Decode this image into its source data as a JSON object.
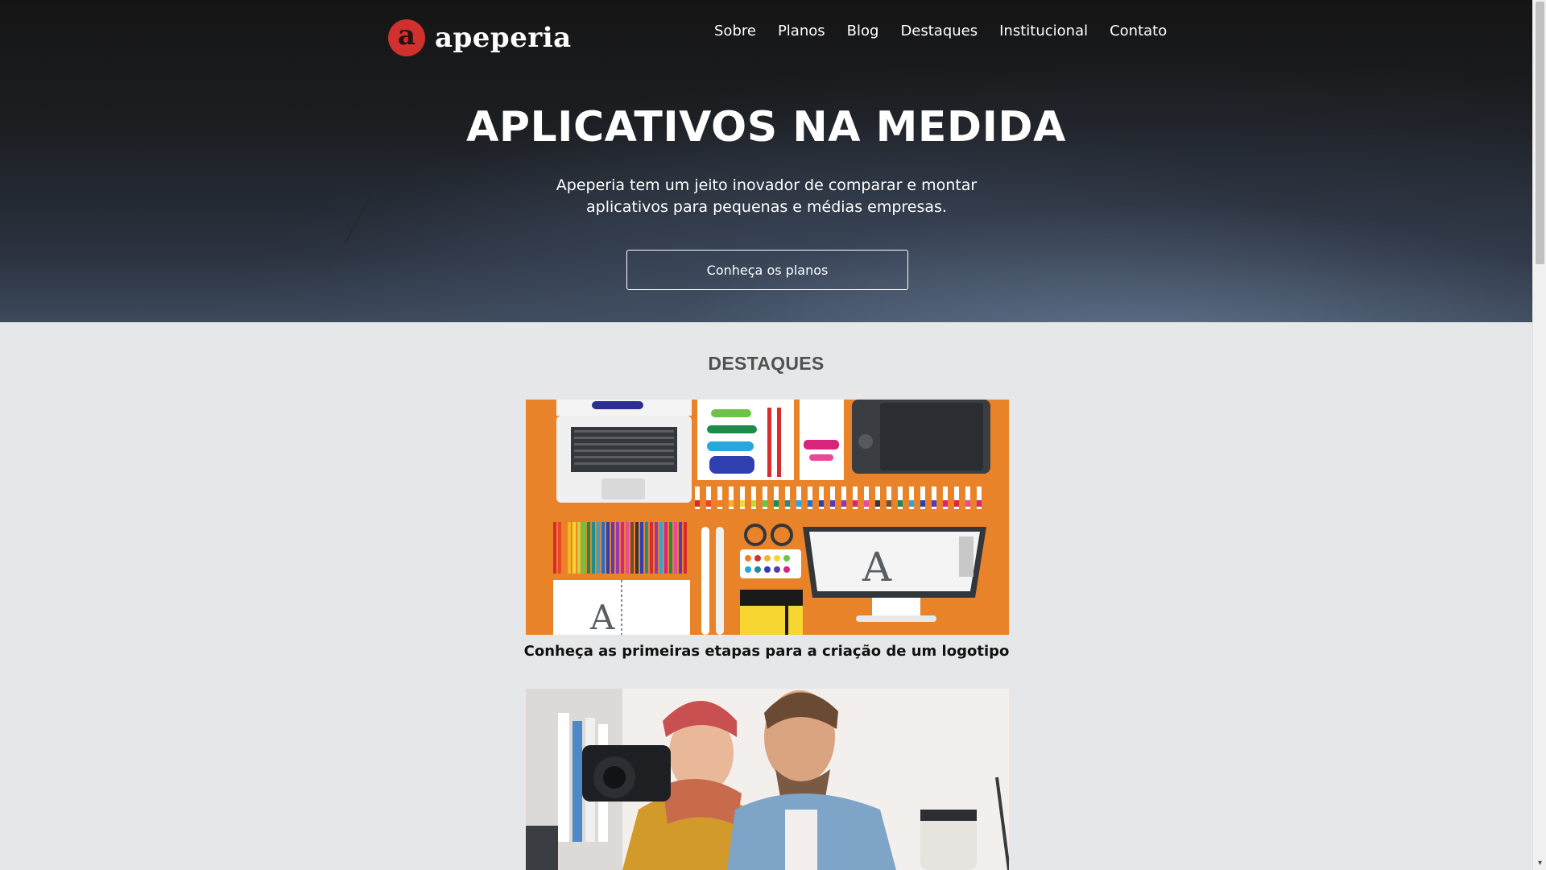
{
  "brand": {
    "name": "apeperia",
    "mark": "a",
    "color": "#d0302e"
  },
  "nav": {
    "items": [
      "Sobre",
      "Planos",
      "Blog",
      "Destaques",
      "Institucional",
      "Contato"
    ]
  },
  "hero": {
    "title": "APLICATIVOS NA MEDIDA",
    "subtitle": "Apeperia tem um jeito inovador de comparar e montar aplicativos para pequenas e médias empresas.",
    "cta_label": "Conheça os planos"
  },
  "destaques": {
    "title": "DESTAQUES",
    "cards": [
      {
        "caption": "Conheça as primeiras etapas para a criação de um logotipo",
        "image": "designer-desk-illustration",
        "accent": "#e88329"
      },
      {
        "caption": "",
        "image": "photographers-with-camera",
        "accent": "#f2efed"
      }
    ]
  }
}
